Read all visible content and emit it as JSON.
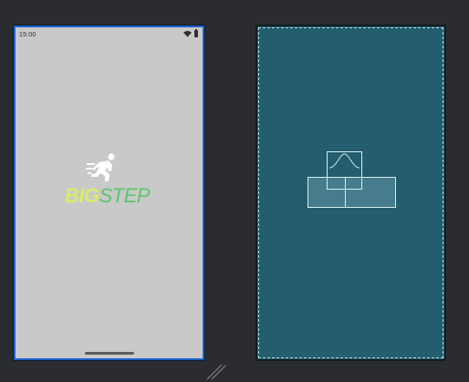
{
  "design_view": {
    "status_bar": {
      "time": "15:00",
      "icons": [
        "wifi-icon",
        "battery-icon"
      ]
    },
    "logo": {
      "icon": "runner-icon",
      "text_part1": "BIG",
      "text_part2": "STEP",
      "colors": {
        "big": "#d9ec6a",
        "step": "#5cc66f"
      }
    },
    "background_color": "#c9c9c9"
  },
  "blueprint_view": {
    "background_color": "#235d6e",
    "components": [
      "image-view-outline",
      "text-view-outline"
    ]
  }
}
